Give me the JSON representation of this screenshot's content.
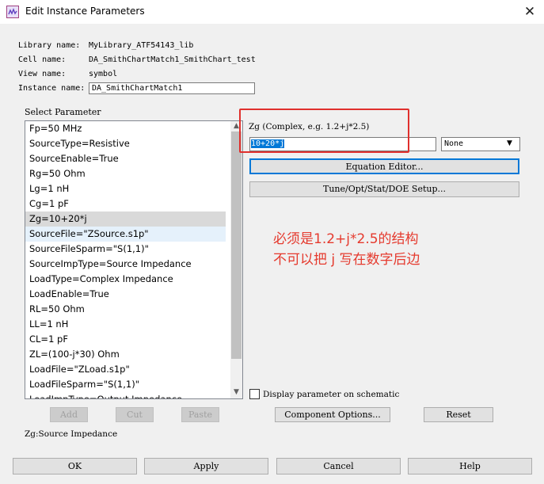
{
  "window": {
    "title": "Edit Instance Parameters",
    "close_glyph": "✕",
    "app_icon": "ads-app-icon"
  },
  "info": {
    "library_label": "Library name:",
    "library_value": "MyLibrary_ATF54143_lib",
    "cell_label": "Cell name:",
    "cell_value": "DA_SmithChartMatch1_SmithChart_test",
    "view_label": "View name:",
    "view_value": "symbol",
    "instance_label": "Instance name:",
    "instance_value": "DA_SmithChartMatch1"
  },
  "params": {
    "heading": "Select Parameter",
    "items": [
      "Fp=50 MHz",
      "SourceType=Resistive",
      "SourceEnable=True",
      "Rg=50 Ohm",
      "Lg=1 nH",
      "Cg=1 pF",
      "Zg=10+20*j",
      "SourceFile=\"ZSource.s1p\"",
      "SourceFileSparm=\"S(1,1)\"",
      "SourceImpType=Source Impedance",
      "LoadType=Complex Impedance",
      "LoadEnable=True",
      "RL=50 Ohm",
      "LL=1 nH",
      "CL=1 pF",
      "ZL=(100-j*30) Ohm",
      "LoadFile=\"ZLoad.s1p\"",
      "LoadFileSparm=\"S(1,1)\"",
      "LoadImpType=Output Impedance"
    ],
    "selected_index": 6,
    "hover_index": 7,
    "scroll_up": "▲",
    "scroll_down": "▼"
  },
  "editor": {
    "param_label": "Zg (Complex, e.g. 1.2+j*2.5)",
    "value": "10+20*j",
    "unit_selected": "None",
    "dropdown_glyph": "▼",
    "equation_editor": "Equation Editor...",
    "tune_setup": "Tune/Opt/Stat/DOE Setup...",
    "display_param": "Display parameter on schematic"
  },
  "annotation": {
    "line1": "必须是1.2+j*2.5的结构",
    "line2": "不可以把 j 写在数字后边"
  },
  "list_buttons": {
    "add": "Add",
    "cut": "Cut",
    "paste": "Paste"
  },
  "component_options": "Component Options...",
  "reset": "Reset",
  "status": "Zg:Source Impedance",
  "bottom_buttons": {
    "ok": "OK",
    "apply": "Apply",
    "cancel": "Cancel",
    "help": "Help"
  },
  "colors": {
    "selection_blue": "#0078d7",
    "annotation_red": "#e53a2e",
    "list_selected": "#d9d9d9"
  }
}
